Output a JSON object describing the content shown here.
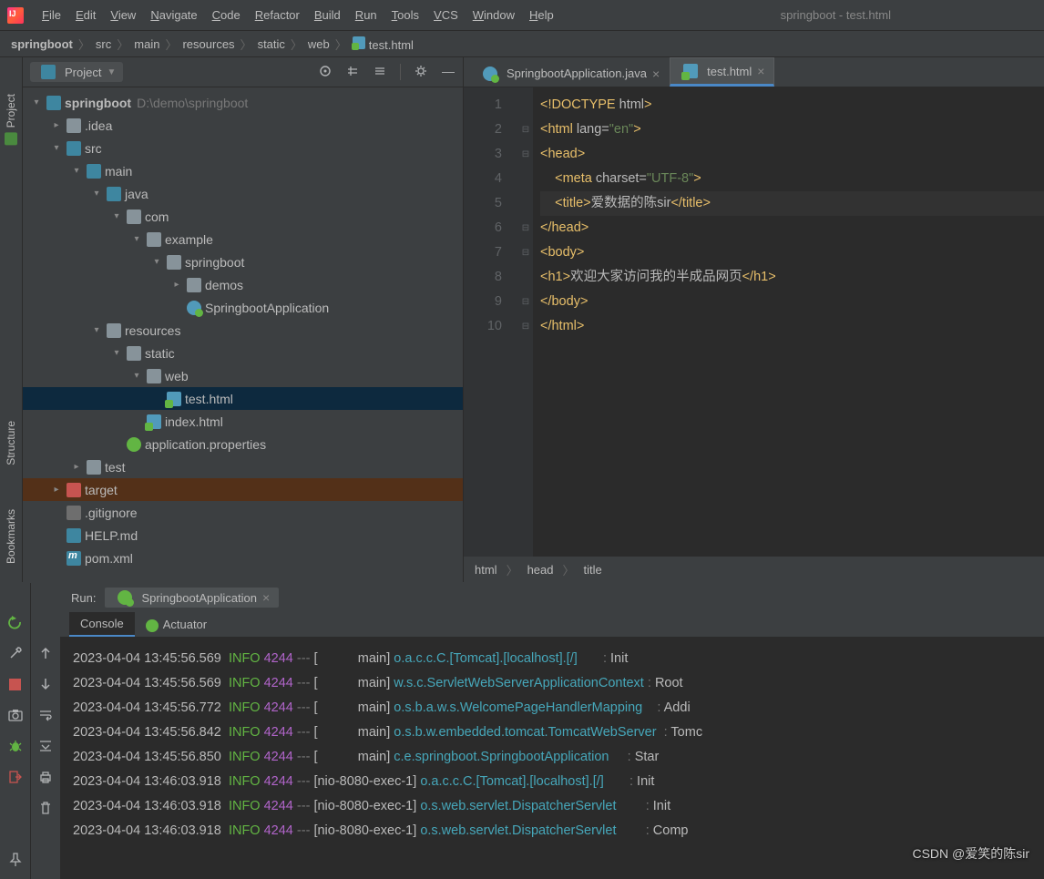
{
  "window_title": "springboot - test.html",
  "menu": [
    "File",
    "Edit",
    "View",
    "Navigate",
    "Code",
    "Refactor",
    "Build",
    "Run",
    "Tools",
    "VCS",
    "Window",
    "Help"
  ],
  "breadcrumbs": [
    "springboot",
    "src",
    "main",
    "resources",
    "static",
    "web",
    "test.html"
  ],
  "left_gutter": {
    "project": "Project",
    "bookmarks": "Bookmarks",
    "structure": "Structure"
  },
  "project_panel": {
    "title": "Project",
    "root": {
      "name": "springboot",
      "path": "D:\\demo\\springboot"
    },
    "tree": [
      {
        "d": 1,
        "exp": "▾",
        "ic": "folder-src",
        "label": "springboot",
        "bold": true,
        "hint": "D:\\demo\\springboot"
      },
      {
        "d": 2,
        "exp": "▸",
        "ic": "folder",
        "label": ".idea"
      },
      {
        "d": 2,
        "exp": "▾",
        "ic": "folder-src",
        "label": "src"
      },
      {
        "d": 3,
        "exp": "▾",
        "ic": "folder-src",
        "label": "main"
      },
      {
        "d": 4,
        "exp": "▾",
        "ic": "folder-src",
        "label": "java"
      },
      {
        "d": 5,
        "exp": "▾",
        "ic": "folder",
        "label": "com"
      },
      {
        "d": 6,
        "exp": "▾",
        "ic": "folder",
        "label": "example"
      },
      {
        "d": 7,
        "exp": "▾",
        "ic": "folder",
        "label": "springboot"
      },
      {
        "d": 8,
        "exp": "▸",
        "ic": "folder",
        "label": "demos"
      },
      {
        "d": 8,
        "exp": "",
        "ic": "java",
        "label": "SpringbootApplication"
      },
      {
        "d": 4,
        "exp": "▾",
        "ic": "folder-res",
        "label": "resources"
      },
      {
        "d": 5,
        "exp": "▾",
        "ic": "folder",
        "label": "static"
      },
      {
        "d": 6,
        "exp": "▾",
        "ic": "folder",
        "label": "web"
      },
      {
        "d": 7,
        "exp": "",
        "ic": "html",
        "label": "test.html",
        "sel": true
      },
      {
        "d": 6,
        "exp": "",
        "ic": "html",
        "label": "index.html"
      },
      {
        "d": 5,
        "exp": "",
        "ic": "prop",
        "label": "application.properties"
      },
      {
        "d": 3,
        "exp": "▸",
        "ic": "folder",
        "label": "test"
      },
      {
        "d": 2,
        "exp": "▸",
        "ic": "folder-exc",
        "label": "target",
        "exc": true
      },
      {
        "d": 2,
        "exp": "",
        "ic": "git",
        "label": ".gitignore"
      },
      {
        "d": 2,
        "exp": "",
        "ic": "md",
        "label": "HELP.md"
      },
      {
        "d": 2,
        "exp": "",
        "ic": "pom",
        "label": "pom.xml"
      }
    ]
  },
  "tabs": [
    {
      "label": "SpringbootApplication.java",
      "icon": "java",
      "active": false
    },
    {
      "label": "test.html",
      "icon": "html",
      "active": true
    }
  ],
  "code_lines": [
    {
      "n": 1,
      "html": "<span class='t-tag'>&lt;!DOCTYPE </span><span class='t-attr'>html</span><span class='t-tag'>&gt;</span>"
    },
    {
      "n": 2,
      "fold": "⊟",
      "html": "<span class='t-tag'>&lt;html </span><span class='t-attr'>lang=</span><span class='t-str'>\"en\"</span><span class='t-tag'>&gt;</span>"
    },
    {
      "n": 3,
      "fold": "⊟",
      "html": "<span class='t-tag'>&lt;head&gt;</span>"
    },
    {
      "n": 4,
      "html": "    <span class='t-tag'>&lt;meta </span><span class='t-attr'>charset=</span><span class='t-str'>\"UTF-8\"</span><span class='t-tag'>&gt;</span>"
    },
    {
      "n": 5,
      "hl": true,
      "html": "    <span class='t-tag'>&lt;title&gt;</span><span class='t-text'>爱数据的陈sir</span><span class='t-tag'>&lt;/title&gt;</span>"
    },
    {
      "n": 6,
      "fold": "⊟",
      "html": "<span class='t-tag'>&lt;/head&gt;</span>"
    },
    {
      "n": 7,
      "fold": "⊟",
      "html": "<span class='t-tag'>&lt;body&gt;</span>"
    },
    {
      "n": 8,
      "html": "<span class='t-tag'>&lt;h1&gt;</span><span class='t-text'>欢迎大家访问我的半成品网页</span><span class='t-tag'>&lt;/h1&gt;</span>"
    },
    {
      "n": 9,
      "fold": "⊟",
      "html": "<span class='t-tag'>&lt;/body&gt;</span>"
    },
    {
      "n": 10,
      "fold": "⊟",
      "html": "<span class='t-tag'>&lt;/html&gt;</span>"
    }
  ],
  "nav_trail": [
    "html",
    "head",
    "title"
  ],
  "run": {
    "label": "Run:",
    "config": "SpringbootApplication",
    "subtabs": [
      "Console",
      "Actuator"
    ],
    "logs": [
      {
        "ts": "2023-04-04 13:45:56.569",
        "lvl": "INFO",
        "pid": "4244",
        "thr": "main",
        "logger": "o.a.c.c.C.[Tomcat].[localhost].[/]",
        "msg": "Init"
      },
      {
        "ts": "2023-04-04 13:45:56.569",
        "lvl": "INFO",
        "pid": "4244",
        "thr": "main",
        "logger": "w.s.c.ServletWebServerApplicationContext",
        "msg": "Root"
      },
      {
        "ts": "2023-04-04 13:45:56.772",
        "lvl": "INFO",
        "pid": "4244",
        "thr": "main",
        "logger": "o.s.b.a.w.s.WelcomePageHandlerMapping",
        "msg": "Addi"
      },
      {
        "ts": "2023-04-04 13:45:56.842",
        "lvl": "INFO",
        "pid": "4244",
        "thr": "main",
        "logger": "o.s.b.w.embedded.tomcat.TomcatWebServer",
        "msg": "Tomc"
      },
      {
        "ts": "2023-04-04 13:45:56.850",
        "lvl": "INFO",
        "pid": "4244",
        "thr": "main",
        "logger": "c.e.springboot.SpringbootApplication",
        "msg": "Star"
      },
      {
        "ts": "2023-04-04 13:46:03.918",
        "lvl": "INFO",
        "pid": "4244",
        "thr": "nio-8080-exec-1",
        "logger": "o.a.c.c.C.[Tomcat].[localhost].[/]",
        "msg": "Init"
      },
      {
        "ts": "2023-04-04 13:46:03.918",
        "lvl": "INFO",
        "pid": "4244",
        "thr": "nio-8080-exec-1",
        "logger": "o.s.web.servlet.DispatcherServlet",
        "msg": "Init"
      },
      {
        "ts": "2023-04-04 13:46:03.918",
        "lvl": "INFO",
        "pid": "4244",
        "thr": "nio-8080-exec-1",
        "logger": "o.s.web.servlet.DispatcherServlet",
        "msg": "Comp"
      }
    ]
  },
  "watermark": "CSDN @爱笑的陈sir"
}
